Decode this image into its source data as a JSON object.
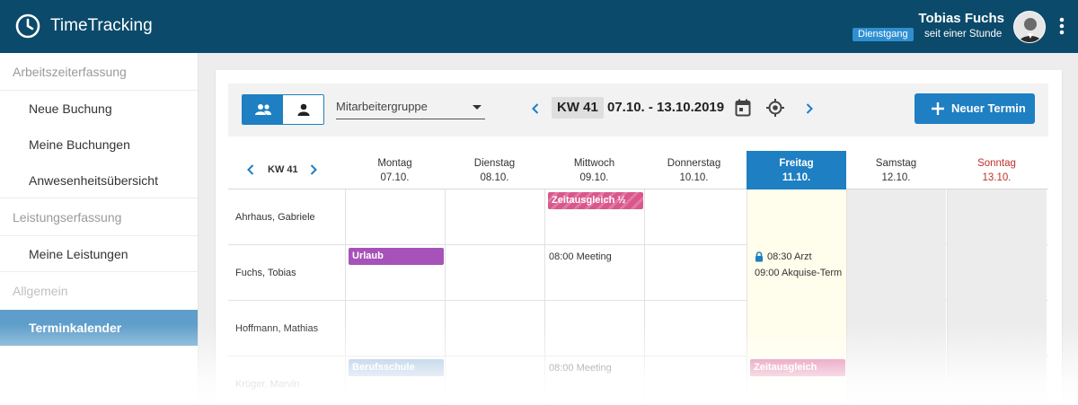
{
  "app": {
    "title": "TimeTracking"
  },
  "user": {
    "name": "Tobias Fuchs",
    "status_badge": "Dienstgang",
    "status_time": "seit einer Stunde"
  },
  "sidebar": {
    "sections": [
      {
        "label": "Arbeitszeiterfassung",
        "items": [
          {
            "label": "Neue Buchung"
          },
          {
            "label": "Meine Buchungen"
          },
          {
            "label": "Anwesenheitsübersicht"
          }
        ]
      },
      {
        "label": "Leistungserfassung",
        "items": [
          {
            "label": "Meine Leistungen"
          }
        ]
      },
      {
        "label": "Allgemein",
        "items": [
          {
            "label": "Terminkalender",
            "active": true
          }
        ]
      }
    ]
  },
  "toolbar": {
    "group_select": "Mitarbeitergruppe",
    "kw": "KW 41",
    "date_range": "07.10. - 13.10.2019",
    "new_button": "Neuer Termin"
  },
  "calendar": {
    "kw_label": "KW 41",
    "days": [
      {
        "name": "Montag",
        "date": "07.10."
      },
      {
        "name": "Dienstag",
        "date": "08.10."
      },
      {
        "name": "Mittwoch",
        "date": "09.10."
      },
      {
        "name": "Donnerstag",
        "date": "10.10."
      },
      {
        "name": "Freitag",
        "date": "11.10.",
        "today": true
      },
      {
        "name": "Samstag",
        "date": "12.10."
      },
      {
        "name": "Sonntag",
        "date": "13.10."
      }
    ],
    "rows": [
      {
        "name": "Ahrhaus, Gabriele",
        "events": [
          {
            "day": 2,
            "label": "Zeitausgleich ½",
            "style": "striped"
          }
        ]
      },
      {
        "name": "Fuchs, Tobias",
        "events": [
          {
            "day": 0,
            "label": "Urlaub",
            "style": "purple"
          },
          {
            "day": 2,
            "label": "08:00 Meeting",
            "style": "text"
          },
          {
            "day": 4,
            "label": "08:30 Arzt",
            "style": "text-lock"
          },
          {
            "day": 4,
            "label": "09:00 Akquise-Term",
            "style": "text2"
          }
        ]
      },
      {
        "name": "Hoffmann, Mathias",
        "events": []
      },
      {
        "name": "Krüger, Marvin",
        "events": [
          {
            "day": 0,
            "label": "Berufsschule",
            "style": "purple"
          },
          {
            "day": 2,
            "label": "08:00 Meeting",
            "style": "text"
          },
          {
            "day": 4,
            "label": "Zeitausgleich",
            "style": "pink"
          }
        ]
      }
    ]
  },
  "colors": {
    "topbar": "#0b4a6a",
    "accent": "#1e7fc2",
    "sidebar_active": "#5f9ecb",
    "today_cell": "#fffdeb",
    "sunday": "#c0302a"
  }
}
